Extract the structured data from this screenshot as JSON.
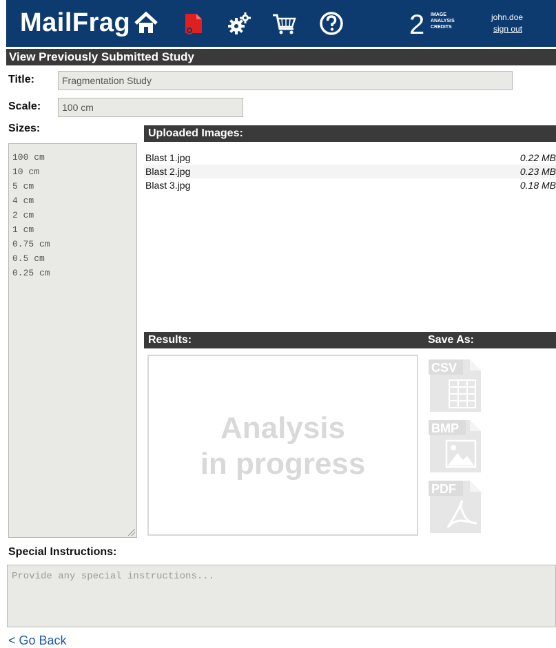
{
  "header": {
    "logo": "MailFrag",
    "credits_count": "2",
    "credits_label": [
      "IMAGE",
      "ANALYSIS",
      "CREDITS"
    ],
    "username": "john.doe",
    "sign_out": "sign out",
    "nav_icons": [
      "home-icon",
      "study-icon",
      "settings-icon",
      "cart-icon",
      "help-icon"
    ]
  },
  "section_title": "View Previously Submitted Study",
  "title_field": {
    "label": "Title:",
    "value": "Fragmentation Study"
  },
  "scale_field": {
    "label": "Scale:",
    "value": "100 cm"
  },
  "sizes": {
    "label": "Sizes:",
    "items": [
      "100 cm",
      "10 cm",
      "5 cm",
      "4 cm",
      "2 cm",
      "1 cm",
      "0.75 cm",
      "0.5 cm",
      "0.25 cm"
    ]
  },
  "uploaded_images": {
    "header": "Uploaded Images:",
    "files": [
      {
        "name": "Blast 1.jpg",
        "size": "0.22 MB"
      },
      {
        "name": "Blast 2.jpg",
        "size": "0.23 MB"
      },
      {
        "name": "Blast 3.jpg",
        "size": "0.18 MB"
      }
    ]
  },
  "results": {
    "header": "Results:",
    "progress_line1": "Analysis",
    "progress_line2": "in progress"
  },
  "save_as": {
    "header": "Save As:",
    "formats": [
      "CSV",
      "BMP",
      "PDF"
    ]
  },
  "special_instructions": {
    "label": "Special Instructions:",
    "placeholder": "Provide any special instructions..."
  },
  "go_back": "< Go Back",
  "colors": {
    "header_bg": "#0d3a6f",
    "bar_bg": "#3a3a3a",
    "accent_red": "#e02020",
    "field_bg": "#e9e9e5",
    "link": "#1a5aa8"
  }
}
